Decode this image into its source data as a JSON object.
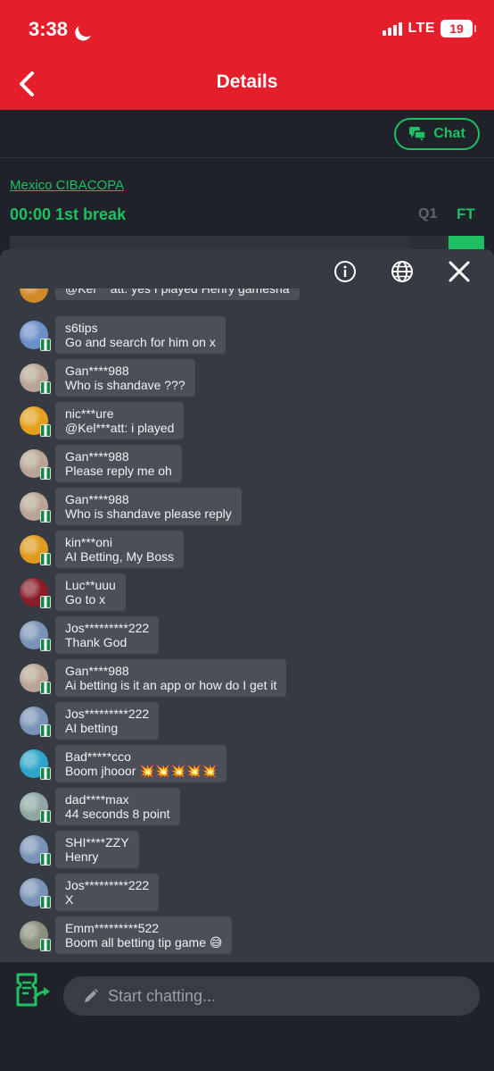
{
  "status": {
    "time": "3:38",
    "network": "LTE",
    "battery": "19"
  },
  "nav": {
    "title": "Details"
  },
  "detail": {
    "chat_label": "Chat",
    "league": "Mexico CIBACOPA",
    "match_status": "00:00 1st break",
    "col_q1": "Q1",
    "col_ft": "FT"
  },
  "messages": [
    {
      "user": "",
      "text": "@Kel***att: yes I played Henry gamesha",
      "avatar": "#d08a2a"
    },
    {
      "user": "s6tips",
      "text": "Go and search for him on x",
      "avatar": "#6d8fc7"
    },
    {
      "user": "Gan****988",
      "text": "Who is shandave ???",
      "avatar": "#b9a595"
    },
    {
      "user": "nic***ure",
      "text": "@Kel***att: i played",
      "avatar": "#e3a11c"
    },
    {
      "user": "Gan****988",
      "text": "Please reply me oh",
      "avatar": "#b9a595"
    },
    {
      "user": "Gan****988",
      "text": "Who is shandave please reply",
      "avatar": "#b9a595"
    },
    {
      "user": "kin***oni",
      "text": "AI Betting, My Boss",
      "avatar": "#e09a1d"
    },
    {
      "user": "Luc**uuu",
      "text": "Go to x",
      "avatar": "#8a1d2a"
    },
    {
      "user": "Jos*********222",
      "text": "Thank God",
      "avatar": "#7a93b8"
    },
    {
      "user": "Gan****988",
      "text": "Ai betting is it an app or how do I get it",
      "avatar": "#b9a595"
    },
    {
      "user": "Jos*********222",
      "text": "AI betting",
      "avatar": "#7a93b8"
    },
    {
      "user": "Bad*****cco",
      "text": "Boom jhooor 💥💥💥💥💥",
      "avatar": "#2fa6c9"
    },
    {
      "user": "dad****max",
      "text": "44 seconds 8 point",
      "avatar": "#8fa7a4"
    },
    {
      "user": "SHI****ZZY",
      "text": "Henry",
      "avatar": "#7a93b8"
    },
    {
      "user": "Jos*********222",
      "text": "X",
      "avatar": "#7a93b8"
    },
    {
      "user": "Emm*********522",
      "text": "Boom all betting tip game 😅",
      "avatar": "#8a8f7e"
    }
  ],
  "input": {
    "placeholder": "Start chatting..."
  },
  "colors": {
    "brand_red": "#e41e2a",
    "accent_green": "#1fbf62",
    "panel": "#363a42",
    "bubble": "#4a4f58"
  }
}
